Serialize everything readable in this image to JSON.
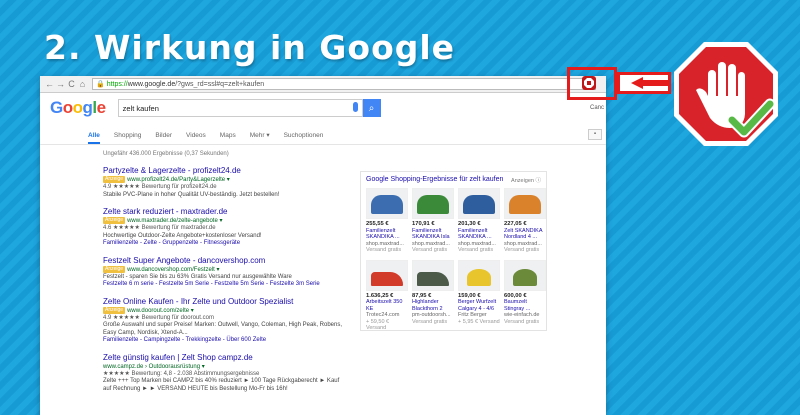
{
  "headline": "2. Wirkung in Google",
  "browser": {
    "nav": {
      "back": "←",
      "forward": "→",
      "reload": "C",
      "home": "⌂"
    },
    "url_scheme": "https://",
    "url_host": "www.google.de",
    "url_rest": "/?gws_rd=ssl#q=zelt+kaufen"
  },
  "google": {
    "logo_letters": [
      "G",
      "o",
      "o",
      "g",
      "l",
      "e"
    ],
    "logo_colors": [
      "#4285f4",
      "#ea4335",
      "#fbbc05",
      "#4285f4",
      "#34a853",
      "#ea4335"
    ],
    "query": "zelt kaufen",
    "cancel": "Canc",
    "tabs": [
      "Alle",
      "Shopping",
      "Bilder",
      "Videos",
      "Maps",
      "Mehr ▾",
      "Suchoptionen"
    ],
    "stats": "Ungefähr 436.000 Ergebnisse (0,37 Sekunden)"
  },
  "results": [
    {
      "title": "Partyzelte & Lagerzelte - profizelt24.de",
      "ad": "Anzeige",
      "url": "www.profizelt24.de/Party&Lagerzelte ▾",
      "rating": "4.9 ★★★★★ Bewertung für profizelt24.de",
      "desc": "Stabile PVC-Plane in hoher Qualität UV-beständig. Jetzt bestellen!",
      "links": ""
    },
    {
      "title": "Zelte stark reduziert - maxtrader.de",
      "ad": "Anzeige",
      "url": "www.maxtrader.de/zelte-angebote ▾",
      "rating": "4.6 ★★★★★ Bewertung für maxtrader.de",
      "desc": "Hochwertige Outdoor-Zelte Angebote+kostenloser Versand!",
      "links": "Familienzelte - Zelte - Gruppenzelte - Fitnessgeräte"
    },
    {
      "title": "Festzelt Super Angebote - dancovershop.com",
      "ad": "Anzeige",
      "url": "www.dancovershop.com/Festzelt ▾",
      "rating": "",
      "desc": "Festzelt - sparen Sie bis zu 63% Gratis Versand nur ausgewählte Ware",
      "links": "Festzelte 6 m serie - Festzelte 5m Serie - Festzelte 5m Serie - Festzelte 3m Serie"
    },
    {
      "title": "Zelte Online Kaufen - Ihr Zelte und Outdoor Spezialist",
      "ad": "Anzeige",
      "url": "www.doorout.com/zelte ▾",
      "rating": "4.9 ★★★★★ Bewertung für doorout.com",
      "desc": "Große Auswahl und super Preise! Marken: Outwell, Vango, Coleman, High Peak, Robens, Easy Camp, Nordisk, Xtend-A...",
      "links": "Familienzelte - Campingzelte - Trekkingzelte - Über 600 Zelte"
    },
    {
      "title": "Zelte günstig kaufen | Zelt Shop campz.de",
      "ad": "",
      "url": "www.campz.de › Outdoorausrüstung ▾",
      "rating": "★★★★★ Bewertung: 4,8 - 2.038 Abstimmungsergebnisse",
      "desc": "Zelte +++ Top Marken bei CAMPZ bis 40% reduziert ► 100 Tage Rückgaberecht ► Kauf auf Rechnung ► ► VERSAND HEUTE bis Bestellung Mo-Fr bis 16h!",
      "links": ""
    }
  ],
  "shopping": {
    "title": "Google Shopping-Ergebnisse für zelt kaufen",
    "ad_label": "Anzeigen ⓘ",
    "items": [
      {
        "price": "255,55 €",
        "name": "Familienzelt SKANDIKA ...",
        "shop": "shop.maxtrad...",
        "meta": "Versand gratis",
        "color": "#3b6db0",
        "shape": "b"
      },
      {
        "price": "170,91 €",
        "name": "Familienzelt SKANDIKA Isla",
        "shop": "shop.maxtrad...",
        "meta": "Versand gratis",
        "color": "#3a8a3a",
        "shape": "b"
      },
      {
        "price": "201,30 €",
        "name": "Familienzelt SKANDIKA ...",
        "shop": "shop.maxtrad...",
        "meta": "Versand gratis",
        "color": "#2f5e9e",
        "shape": "b"
      },
      {
        "price": "227,05 €",
        "name": "Zelt SKANDIKA Nordland 4 ...",
        "shop": "shop.maxtrad...",
        "meta": "Versand gratis",
        "color": "#d9822b",
        "shape": "b"
      },
      {
        "price": "1.636,25 €",
        "name": "Arbeitszelt 350 KE",
        "shop": "Trotec24.com",
        "meta": "+ 59,50 € Versand",
        "color": "#d23a2a",
        "shape": "a"
      },
      {
        "price": "87,95 €",
        "name": "Highlander Blackthorn 2",
        "shop": "pm-outdoorsh...",
        "meta": "Versand gratis",
        "color": "#4c5a4a",
        "shape": "a"
      },
      {
        "price": "159,00 €",
        "name": "Berger Wurfzelt Calgary 4 - 4/6",
        "shop": "Fritz Berger",
        "meta": "+ 5,95 € Versand",
        "color": "#e8c52c",
        "shape": "c"
      },
      {
        "price": "600,00 €",
        "name": "Baumzelt Stingray ...",
        "shop": "wie-einfach.de",
        "meta": "Versand gratis",
        "color": "#6b8a3a",
        "shape": "c"
      }
    ]
  },
  "colors": {
    "accent": "#e51c1c",
    "stop_red": "#d8232a",
    "check_green": "#58b947",
    "google_blue": "#4285f4",
    "link": "#1a0dab",
    "url": "#006621"
  },
  "icons": {
    "adblock": "adblock-icon",
    "stop": "stop-hand-icon",
    "check": "checkmark-icon",
    "arrow": "arrow-left-icon"
  }
}
